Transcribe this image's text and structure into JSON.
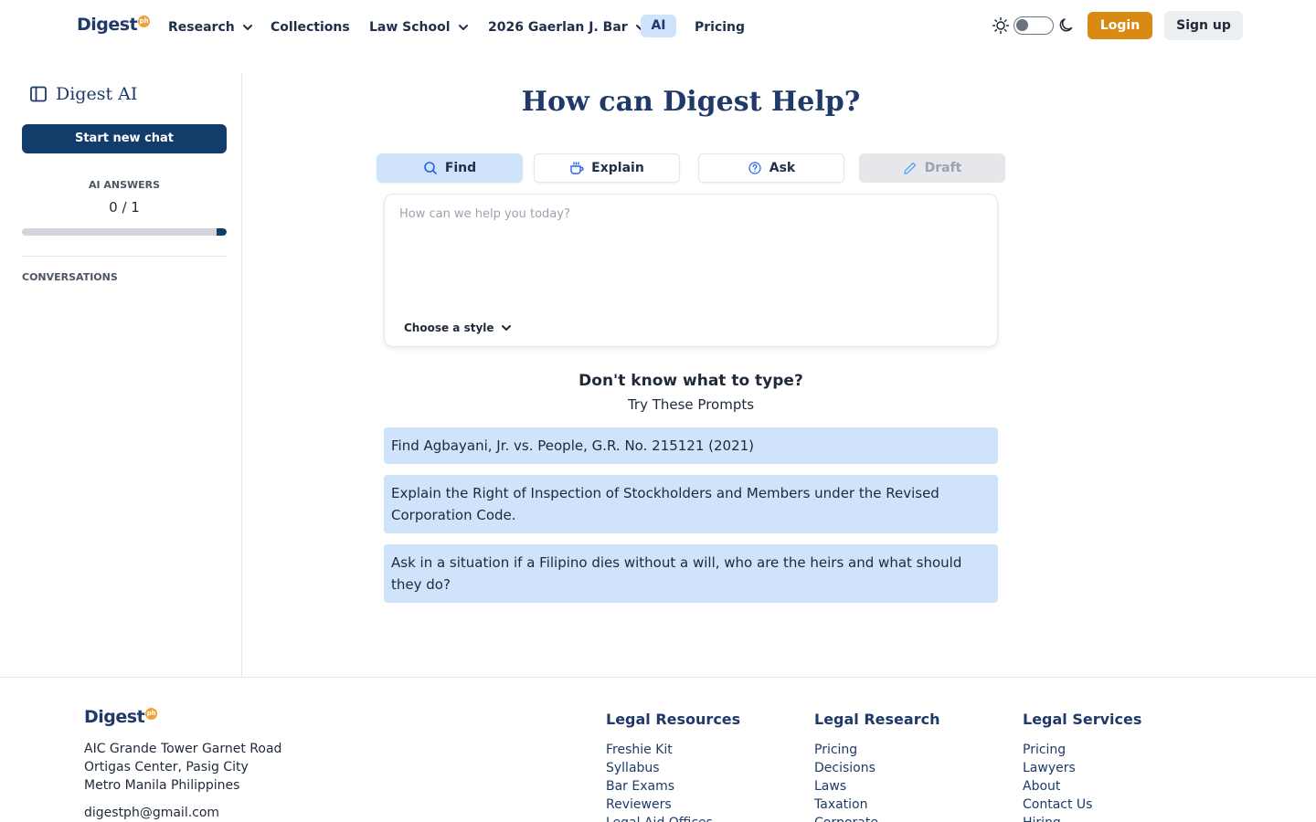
{
  "brand": {
    "name": "Digest",
    "badge": "ph"
  },
  "nav": {
    "items": [
      {
        "label": "Research"
      },
      {
        "label": "Collections"
      },
      {
        "label": "Law School"
      },
      {
        "label": "2026 Gaerlan J. Bar"
      },
      {
        "label": "AI"
      },
      {
        "label": "Pricing"
      }
    ],
    "login": "Login",
    "signup": "Sign up"
  },
  "sidebar": {
    "title": "Digest AI",
    "new_chat": "Start new chat",
    "answers_label": "AI ANSWERS",
    "answers_count": "0 / 1",
    "answers_progress": 0.05,
    "conversations_label": "CONVERSATIONS"
  },
  "main": {
    "title": "How can Digest Help?",
    "modes": [
      {
        "label": "Find",
        "icon": "search-icon",
        "active": true
      },
      {
        "label": "Explain",
        "icon": "coffee-icon",
        "active": false
      },
      {
        "label": "Ask",
        "icon": "question-circle-icon",
        "active": false
      },
      {
        "label": "Draft",
        "icon": "pencil-icon",
        "disabled": true
      }
    ],
    "prompt_placeholder": "How can we help you today?",
    "style_select": "Choose a style",
    "hint_title": "Don't know what to type?",
    "hint_subtitle": "Try These Prompts",
    "suggestions": [
      "Find Agbayani, Jr. vs. People, G.R. No. 215121 (2021)",
      "Explain the Right of Inspection of Stockholders and Members under the Revised Corporation Code.",
      "Ask in a situation if a Filipino dies without a will, who are the heirs and what should they do?"
    ]
  },
  "footer": {
    "address": [
      "AIC Grande Tower Garnet Road",
      "Ortigas Center, Pasig City",
      "Metro Manila Philippines"
    ],
    "email": "digestph@gmail.com",
    "columns": [
      {
        "title": "Legal Resources",
        "links": [
          "Freshie Kit",
          "Syllabus",
          "Bar Exams",
          "Reviewers",
          "Legal Aid Offices"
        ]
      },
      {
        "title": "Legal Research",
        "links": [
          "Pricing",
          "Decisions",
          "Laws",
          "Taxation",
          "Corporate"
        ]
      },
      {
        "title": "Legal Services",
        "links": [
          "Pricing",
          "Lawyers",
          "About",
          "Contact Us",
          "Hiring"
        ]
      }
    ]
  },
  "colors": {
    "primary": "#123d6a",
    "accent": "#d98a12",
    "highlight": "#cfe3fa"
  }
}
